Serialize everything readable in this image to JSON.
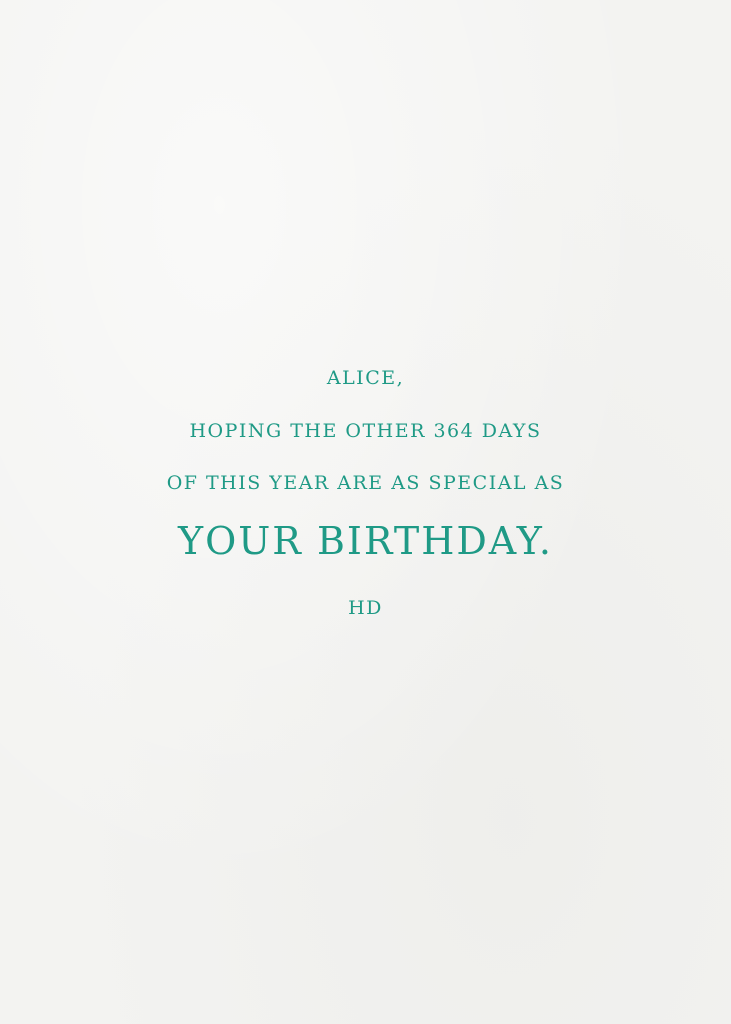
{
  "card": {
    "greeting": "ALICE,",
    "line1": "HOPING THE OTHER 364 DAYS",
    "line2": "OF THIS YEAR ARE AS SPECIAL AS",
    "emphasis": "YOUR BIRTHDAY.",
    "signoff": "HD",
    "text_color": "#1f9a86",
    "paper_color": "#f3f3f1"
  }
}
